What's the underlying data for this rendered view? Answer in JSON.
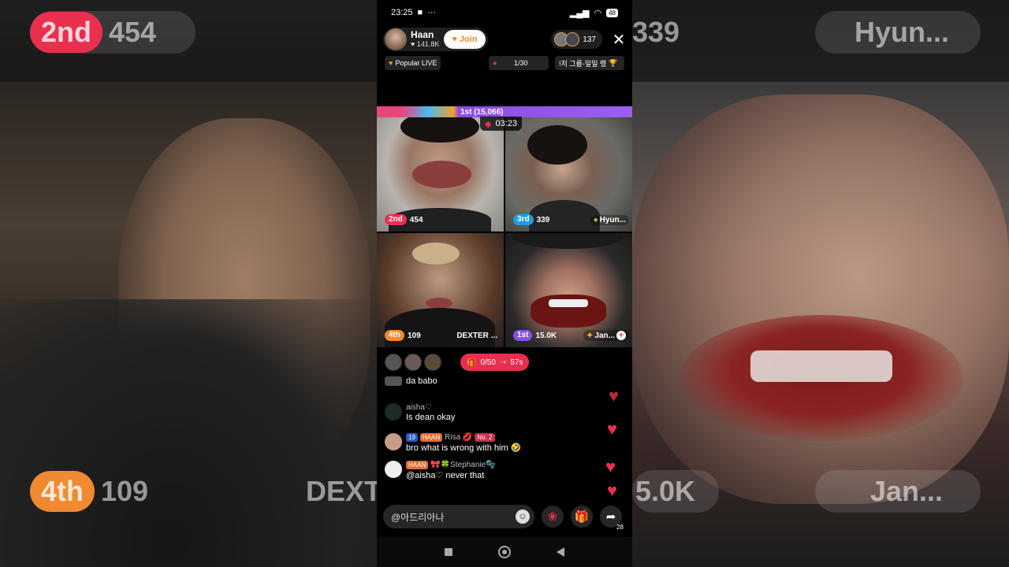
{
  "statusbar": {
    "time": "23:25",
    "battery": "48"
  },
  "host": {
    "name": "Haan",
    "likes": "141.8K",
    "join_label": "Join"
  },
  "viewers": {
    "count": "137"
  },
  "tags": {
    "popular": "Popular LIVE",
    "progress": "1/30",
    "notice": "!저 그룹-일일 랭"
  },
  "battle": {
    "leader": "1st (15,066)",
    "timer": "03:23"
  },
  "tiles": [
    {
      "rank": "2nd",
      "score": "454",
      "rank_color": "#e8304e"
    },
    {
      "rank": "3rd",
      "score": "339",
      "name": "Hyun...",
      "rank_color": "#1e9ee0"
    },
    {
      "rank": "4th",
      "score": "109",
      "name": "DEXTER ...",
      "rank_color": "#f08a30"
    },
    {
      "rank": "1st",
      "score": "15.0K",
      "name": "Jan...",
      "rank_color": "#8a4ee0"
    }
  ],
  "gift_goal": {
    "progress": "0/50",
    "time_left": "57s"
  },
  "chat": [
    {
      "user": "",
      "text": "da babo"
    },
    {
      "user": "aisha♡",
      "text": "Is dean okay"
    },
    {
      "user": "Risa 💋",
      "badges": [
        "19",
        "HAAN",
        "No. 2"
      ],
      "text": "bro what is wrong with him 🤣"
    },
    {
      "user": "🎀🍀Stephanie🫧",
      "badges": [
        "HAAN"
      ],
      "text": "@aisha♡ never that"
    }
  ],
  "comment": {
    "placeholder": "@아드리아나"
  },
  "share": {
    "count": "28"
  },
  "background": {
    "left_rank": "2nd",
    "left_score": "454",
    "left_bottom_rank": "4th",
    "left_bottom_score": "109",
    "left_bottom_name": "DEXT",
    "right_score_top": "339",
    "right_name_top": "Hyun...",
    "right_score_bottom": "5.0K",
    "right_name_bottom": "Jan..."
  },
  "icons": {
    "close": "close-icon",
    "heart": "heart-icon",
    "gift": "gift-icon",
    "rose": "rose-icon",
    "share": "share-icon",
    "emoji": "emoji-icon",
    "nav_back": "back-icon",
    "nav_home": "home-icon",
    "nav_recents": "recents-icon"
  }
}
